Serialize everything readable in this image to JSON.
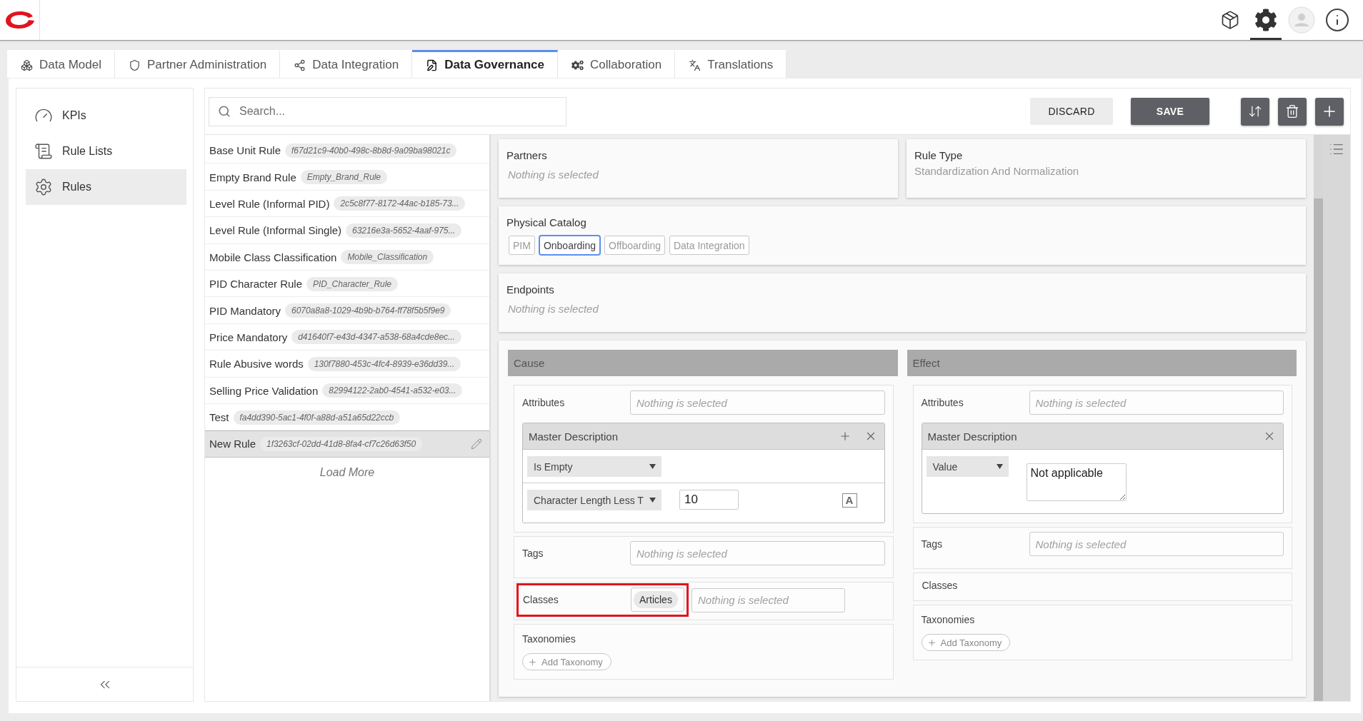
{
  "header": {
    "icons": [
      {
        "kind": "package",
        "selected": false
      },
      {
        "kind": "settings",
        "selected": true
      },
      {
        "kind": "avatar",
        "selected": false
      },
      {
        "kind": "info",
        "selected": false
      }
    ]
  },
  "tabs": [
    {
      "label": "Data Model",
      "kind": "model",
      "selected": false
    },
    {
      "label": "Partner Administration",
      "kind": "partners",
      "selected": false
    },
    {
      "label": "Data Integration",
      "kind": "integration",
      "selected": false
    },
    {
      "label": "Data Governance",
      "kind": "governance",
      "selected": true
    },
    {
      "label": "Collaboration",
      "kind": "collaboration",
      "selected": false
    },
    {
      "label": "Translations",
      "kind": "translations",
      "selected": false
    }
  ],
  "sidebar": {
    "items": [
      {
        "label": "KPIs",
        "kind": "kpis",
        "selected": false
      },
      {
        "label": "Rule Lists",
        "kind": "lists",
        "selected": false
      },
      {
        "label": "Rules",
        "kind": "rules",
        "selected": true
      }
    ]
  },
  "toolbar": {
    "search": {
      "placeholder": "Search..."
    },
    "discard": "DISCARD",
    "save": "SAVE"
  },
  "rules": {
    "items": [
      {
        "name": "Base Unit Rule",
        "id": "f67d21c9-40b0-498c-8b8d-9a09ba98021c",
        "selected": false
      },
      {
        "name": "Empty Brand Rule",
        "id": "Empty_Brand_Rule",
        "selected": false
      },
      {
        "name": "Level Rule (Informal PID)",
        "id": "2c5c8f77-8172-44ac-b185-73...",
        "selected": false
      },
      {
        "name": "Level Rule (Informal Single)",
        "id": "63216e3a-5652-4aaf-975...",
        "selected": false
      },
      {
        "name": "Mobile Class Classification",
        "id": "Mobile_Classification",
        "selected": false
      },
      {
        "name": "PID Character Rule",
        "id": "PID_Character_Rule",
        "selected": false
      },
      {
        "name": "PID Mandatory",
        "id": "6070a8a8-1029-4b9b-b764-ff78f5b5f9e9",
        "selected": false
      },
      {
        "name": "Price Mandatory",
        "id": "d41640f7-e43d-4347-a538-68a4cde8ec...",
        "selected": false
      },
      {
        "name": "Rule Abusive words",
        "id": "130f7880-453c-4fc4-8939-e36dd39...",
        "selected": false
      },
      {
        "name": "Selling Price Validation",
        "id": "82994122-2ab0-4541-a532-e03...",
        "selected": false
      },
      {
        "name": "Test",
        "id": "fa4dd390-5ac1-4f0f-a88d-a51a65d22ccb",
        "selected": false
      },
      {
        "name": "New Rule",
        "id": "1f3263cf-02dd-41d8-8fa4-cf7c26d63f50",
        "selected": true
      }
    ],
    "load_more": "Load More"
  },
  "detail": {
    "partners": {
      "label": "Partners",
      "placeholder": "Nothing is selected"
    },
    "rule_type": {
      "label": "Rule Type",
      "value": "Standardization And Normalization"
    },
    "physical_catalog": {
      "label": "Physical Catalog",
      "options": [
        {
          "label": "PIM",
          "selected": false
        },
        {
          "label": "Onboarding",
          "selected": true
        },
        {
          "label": "Offboarding",
          "selected": false
        },
        {
          "label": "Data Integration",
          "selected": false
        }
      ]
    },
    "endpoints": {
      "label": "Endpoints",
      "placeholder": "Nothing is selected"
    },
    "cause": {
      "title": "Cause",
      "attributes": {
        "label": "Attributes",
        "placeholder": "Nothing is selected",
        "conditions": [
          {
            "title": "Master Description",
            "addable": true,
            "rows": [
              {
                "kind": "select",
                "operator": "Is Empty"
              },
              {
                "kind": "number",
                "operator": "Character Length Less T",
                "value": "10",
                "toggle": "A"
              }
            ]
          }
        ]
      },
      "tags": {
        "label": "Tags",
        "placeholder": "Nothing is selected"
      },
      "classes": {
        "label": "Classes",
        "highlighted": true,
        "chips": [
          "Articles"
        ],
        "placeholder": "Nothing is selected"
      },
      "taxonomies": {
        "label": "Taxonomies",
        "button": "Add Taxonomy"
      }
    },
    "effect": {
      "title": "Effect",
      "attributes": {
        "label": "Attributes",
        "placeholder": "Nothing is selected",
        "conditions": [
          {
            "title": "Master Description",
            "addable": false,
            "rows": [
              {
                "kind": "text",
                "operator": "Value",
                "text": "Not applicable"
              }
            ]
          }
        ]
      },
      "tags": {
        "label": "Tags",
        "placeholder": "Nothing is selected"
      },
      "classes": {
        "label": "Classes",
        "highlighted": false
      },
      "taxonomies": {
        "label": "Taxonomies",
        "button": "Add Taxonomy"
      }
    }
  }
}
